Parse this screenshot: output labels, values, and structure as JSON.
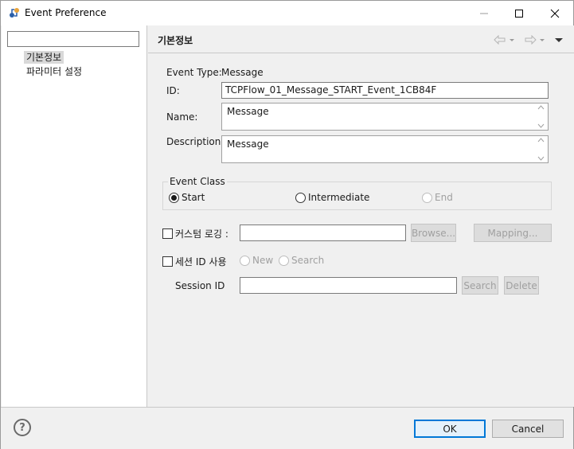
{
  "window": {
    "title": "Event Preference"
  },
  "tree": {
    "filter_value": "",
    "items": [
      {
        "label": "기본정보",
        "selected": true
      },
      {
        "label": "파라미터 설정",
        "selected": false
      }
    ]
  },
  "page": {
    "title": "기본정보",
    "event_type_label": "Event Type:",
    "event_type_value": "Message",
    "id_label": "ID:",
    "id_value": "TCPFlow_01_Message_START_Event_1CB84F",
    "name_label": "Name:",
    "name_value": "Message",
    "description_label": "Description:",
    "description_value": "Message",
    "event_class": {
      "legend": "Event Class",
      "options": [
        {
          "label": "Start",
          "checked": true,
          "enabled": true
        },
        {
          "label": "Intermediate",
          "checked": false,
          "enabled": true
        },
        {
          "label": "End",
          "checked": false,
          "enabled": false
        }
      ]
    },
    "custom_logging": {
      "label": "커스텀 로깅 :",
      "checked": false,
      "value": "",
      "browse_label": "Browse...",
      "mapping_label": "Mapping..."
    },
    "session": {
      "checkbox_label": "세션 ID 사용",
      "checked": false,
      "new_label": "New",
      "search_label": "Search",
      "session_id_label": "Session ID",
      "session_id_value": "",
      "search_button_label": "Search",
      "delete_button_label": "Delete"
    }
  },
  "footer": {
    "help_glyph": "?",
    "ok_label": "OK",
    "cancel_label": "Cancel"
  },
  "colors": {
    "default_button_border": "#0078d7",
    "selection_bg": "#d9d9d9",
    "disabled_text": "#a0a0a0"
  }
}
